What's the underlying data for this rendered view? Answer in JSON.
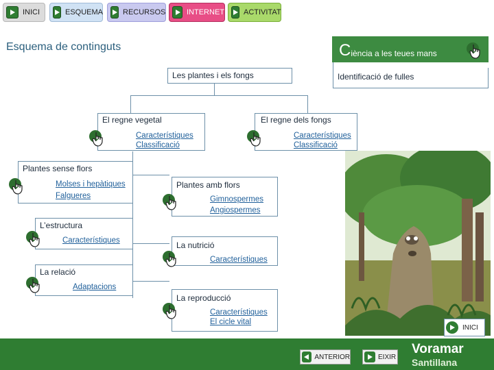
{
  "nav": {
    "inici": "INICI",
    "esquema": "ESQUEMA",
    "recursos": "RECURSOS",
    "internet": "INTERNET",
    "activitat": "ACTIVITAT"
  },
  "page_title": "Esquema de continguts",
  "brand": {
    "big_letter": "C",
    "rest": "iència a les teues mans"
  },
  "map": {
    "root": "Les plantes i els fongs",
    "identification": "Identificació de fulles",
    "vegetal": {
      "title": "El regne vegetal",
      "links": [
        "Característiques",
        "Classificació"
      ]
    },
    "fungi": {
      "title": "El regne dels fongs",
      "links": [
        "Característiques",
        "Classificació"
      ]
    },
    "no_flowers": {
      "title": "Plantes sense flors",
      "links": [
        "Molses i hepàtiques",
        "Falgueres"
      ]
    },
    "flowers": {
      "title": "Plantes amb flors",
      "links": [
        "Gimnospermes",
        "Angiospermes"
      ]
    },
    "structure": {
      "title": "L’estructura",
      "links": [
        "Característiques"
      ]
    },
    "nutrition": {
      "title": "La nutrició",
      "links": [
        "Característiques"
      ]
    },
    "relation": {
      "title": "La relació",
      "links": [
        "Adaptacions"
      ]
    },
    "reproduction": {
      "title": "La reproducció",
      "links": [
        "Característiques",
        "El cicle vital"
      ]
    }
  },
  "bottom": {
    "inici": "INICI",
    "anterior": "ANTERIOR",
    "eixir": "EIXIR",
    "publisher_line1": "Voramar",
    "publisher_line2": "Santillana"
  },
  "colors": {
    "accent_green": "#2f7d32",
    "link_blue": "#1f5f9a",
    "border_blue": "#6c8fa8"
  }
}
